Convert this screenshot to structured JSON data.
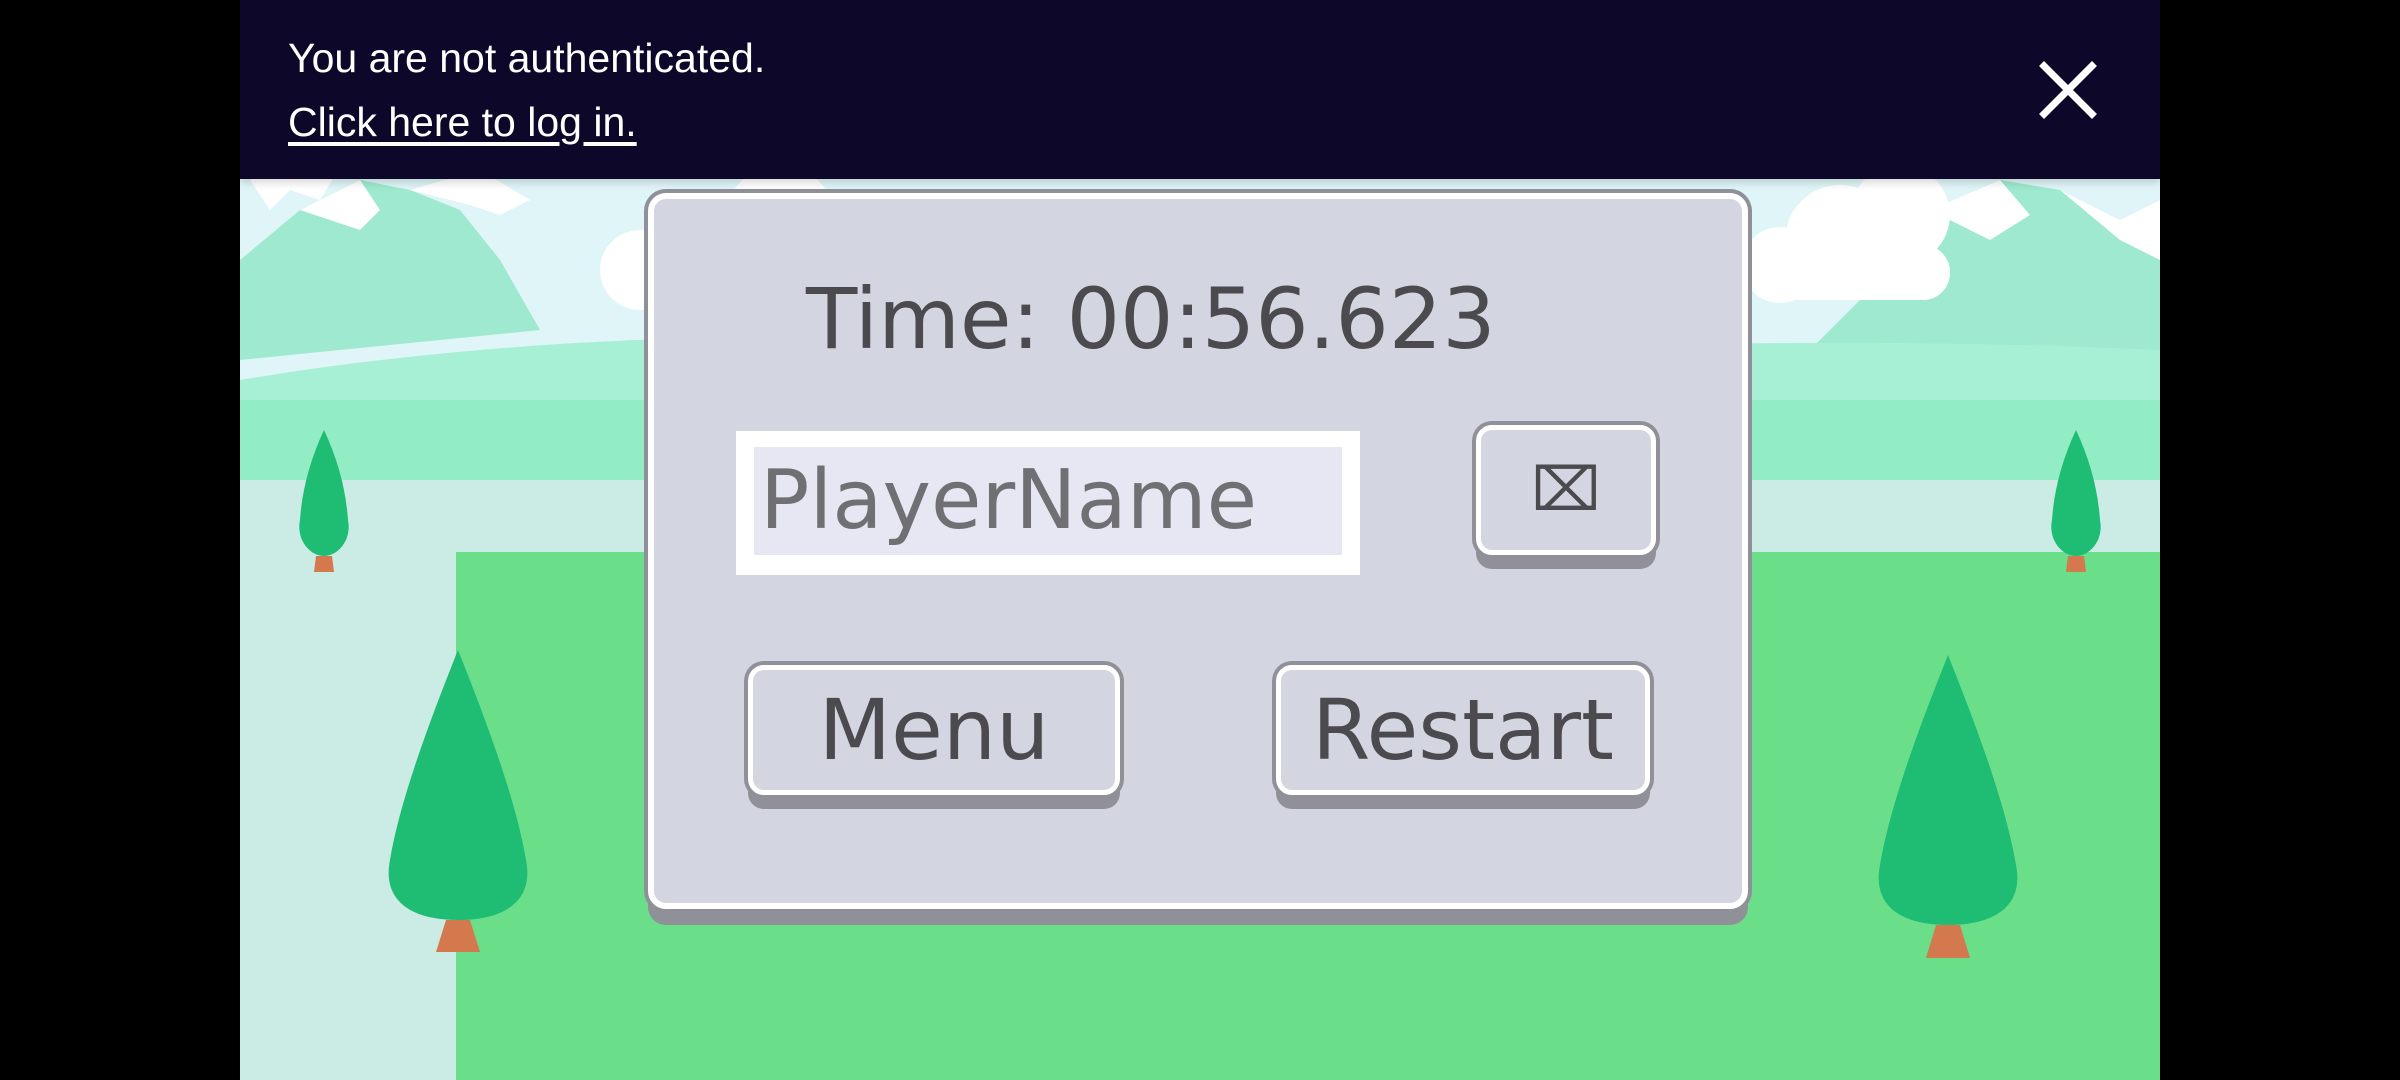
{
  "auth_banner": {
    "message": "You are not authenticated.",
    "login_link": "Click here to log in.",
    "close_icon": "close-icon"
  },
  "game_over_panel": {
    "time_label": "Time: 00:56.623",
    "name_input": {
      "value": "",
      "placeholder": "PlayerName"
    },
    "fullscreen_button": {
      "icon": "missing-glyph-icon",
      "label": "⌧"
    },
    "menu_button": "Menu",
    "restart_button": "Restart"
  },
  "colors": {
    "banner_background": "#0d082a",
    "panel_background": "#d3d5e1",
    "panel_text": "#4a4a4f",
    "grass": "#6bde8a",
    "tree_foliage": "#1fbd74",
    "tree_trunk": "#d4794e"
  }
}
